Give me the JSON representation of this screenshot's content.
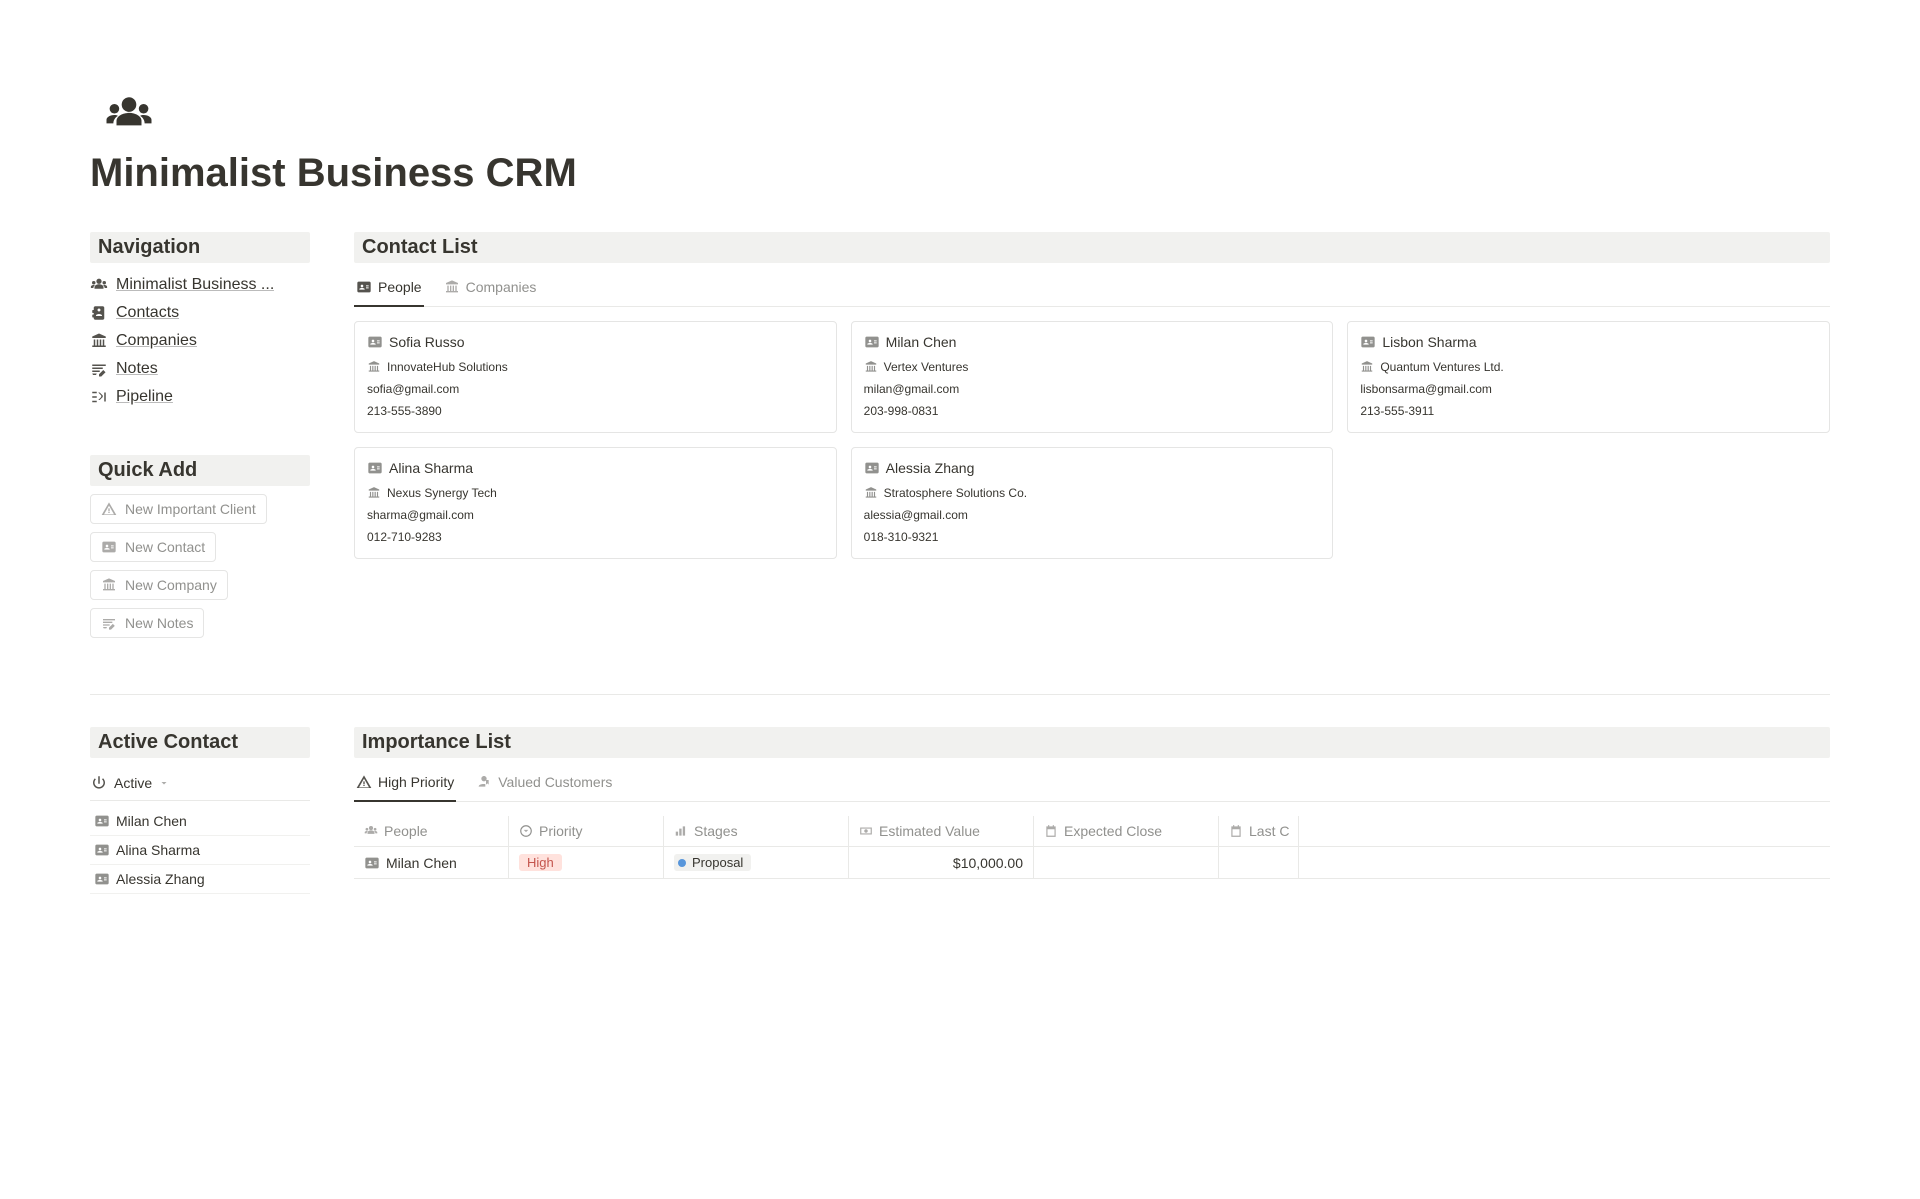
{
  "page": {
    "title": "Minimalist Business CRM"
  },
  "sidebar": {
    "navigation_header": "Navigation",
    "items": [
      {
        "label": "Minimalist Business ..."
      },
      {
        "label": "Contacts"
      },
      {
        "label": "Companies"
      },
      {
        "label": "Notes"
      },
      {
        "label": "Pipeline"
      }
    ]
  },
  "quick_add": {
    "header": "Quick Add",
    "buttons": [
      {
        "label": "New Important Client"
      },
      {
        "label": "New Contact"
      },
      {
        "label": "New Company"
      },
      {
        "label": "New Notes"
      }
    ]
  },
  "contact_list": {
    "header": "Contact List",
    "tabs": [
      {
        "label": "People"
      },
      {
        "label": "Companies"
      }
    ],
    "cards": [
      {
        "name": "Sofia Russo",
        "company": "InnovateHub Solutions",
        "email": "sofia@gmail.com",
        "phone": "213-555-3890"
      },
      {
        "name": "Milan Chen",
        "company": "Vertex Ventures",
        "email": "milan@gmail.com",
        "phone": "203-998-0831"
      },
      {
        "name": "Lisbon Sharma",
        "company": "Quantum Ventures Ltd.",
        "email": "lisbonsarma@gmail.com",
        "phone": "213-555-3911"
      },
      {
        "name": "Alina Sharma",
        "company": "Nexus Synergy Tech",
        "email": "sharma@gmail.com",
        "phone": "012-710-9283"
      },
      {
        "name": "Alessia Zhang",
        "company": "Stratosphere Solutions Co.",
        "email": "alessia@gmail.com",
        "phone": "018-310-9321"
      }
    ]
  },
  "active_contact": {
    "header": "Active Contact",
    "view_label": "Active",
    "rows": [
      {
        "name": "Milan Chen"
      },
      {
        "name": "Alina Sharma"
      },
      {
        "name": "Alessia Zhang"
      }
    ]
  },
  "importance_list": {
    "header": "Importance List",
    "tabs": [
      {
        "label": "High Priority"
      },
      {
        "label": "Valued Customers"
      }
    ],
    "columns": [
      {
        "label": "People"
      },
      {
        "label": "Priority"
      },
      {
        "label": "Stages"
      },
      {
        "label": "Estimated Value"
      },
      {
        "label": "Expected Close"
      },
      {
        "label": "Last C"
      }
    ],
    "rows": [
      {
        "person": "Milan Chen",
        "priority": "High",
        "stage": "Proposal",
        "estimated_value": "$10,000.00",
        "expected_close": "",
        "last_c": ""
      }
    ]
  }
}
